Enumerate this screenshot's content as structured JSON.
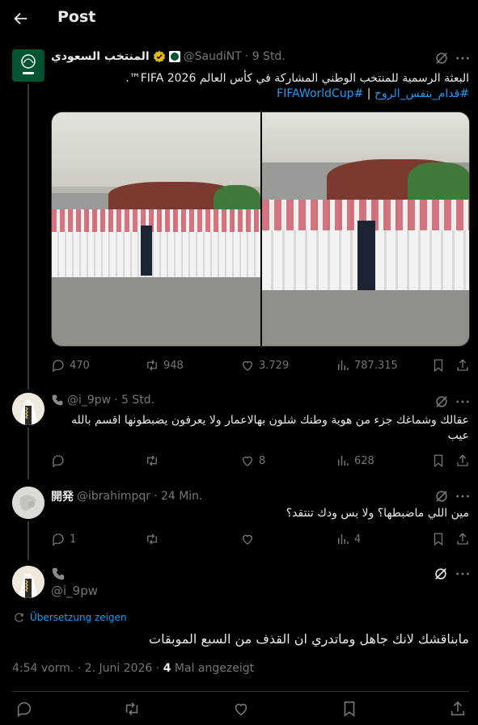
{
  "header": {
    "title": "Post"
  },
  "post": {
    "name": "المنتخب السعودي",
    "handle": "@SaudiNT",
    "time": "· 9 Std.",
    "line1": "البعثة الرسمية للمنتخب الوطني المشاركة في كأس العالم FIFA 2026™.",
    "hashtag1": "#قدام_بنفس_الروح",
    "sep": "|",
    "hashtag2": "#FIFAWorldCup",
    "stats": {
      "replies": "470",
      "reposts": "948",
      "likes": "3.729",
      "views": "787.315"
    }
  },
  "reply1": {
    "handle": "@i_9pw",
    "time": "· 5 Std.",
    "text": "عقالك وشماغك جزء من هوية وطنك شلون بهالاعمار ولا يعرفون يضبطونها اقسم بالله عيب",
    "stats": {
      "replies": "",
      "reposts": "",
      "likes": "8",
      "views": "628"
    }
  },
  "reply2": {
    "name": "開発",
    "handle": "@ibrahimpqr",
    "time": "· 24 Min.",
    "text": "مين اللي ماضبطها؟ ولا بس ودك تنتقد؟",
    "stats": {
      "replies": "1",
      "reposts": "",
      "likes": "",
      "views": "4"
    }
  },
  "main": {
    "handle": "@i_9pw",
    "translate": "Übersetzung zeigen",
    "text": "مابناقشك لانك جاهل وماتدري ان القذف من السبع الموبقات",
    "timestamp": "4:54 vorm. · 2. Juni 2026 ·",
    "views_count": "4",
    "views_label": "Mal angezeigt"
  },
  "colors": {
    "accent": "#1d9bf0",
    "muted": "#71767b",
    "text": "#e7e9ea",
    "verified": "#e2b719",
    "saudi_green": "#005430"
  }
}
